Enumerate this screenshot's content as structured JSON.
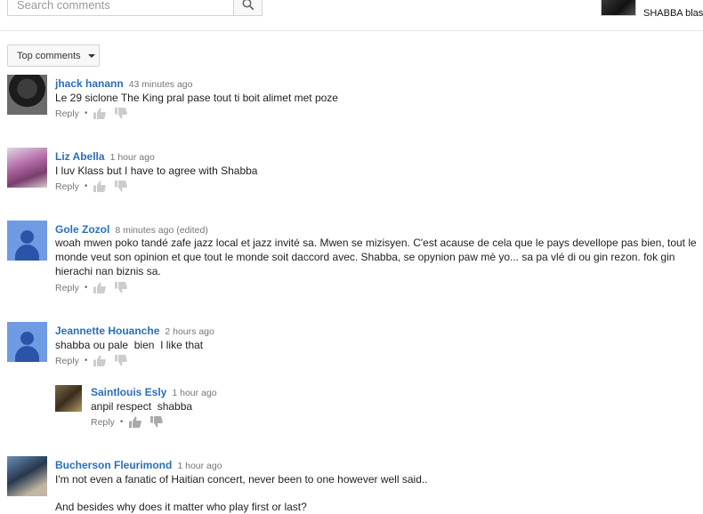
{
  "search": {
    "placeholder": "Search comments"
  },
  "channel": {
    "name": "SHABBA blast"
  },
  "sort": {
    "label": "Top comments"
  },
  "actions": {
    "reply": "Reply",
    "separator": "•"
  },
  "comments": [
    {
      "author": "jhack hanann",
      "time": "43 minutes ago",
      "text": "Le 29 siclone The King pral pase tout ti boit alimet met poze"
    },
    {
      "author": "Liz Abella",
      "time": "1 hour ago",
      "text": "I luv Klass but I have to agree with Shabba"
    },
    {
      "author": "Gole Zozol",
      "time": "8 minutes ago (edited)",
      "text": "woah mwen poko tandé zafe jazz local et jazz invité sa. Mwen se mizisyen. C'est acause de cela que le pays devellope pas bien, tout le monde veut son opinion et que tout le monde soit daccord avec. Shabba, se opynion paw mè yo... sa pa vlé di ou gin rezon. fok gin hierachi nan biznis sa."
    },
    {
      "author": "Jeannette Houanche",
      "time": "2 hours ago",
      "text": "shabba ou pale  bien  I like that"
    },
    {
      "author": "Saintlouis Esly",
      "time": "1 hour ago",
      "text": "anpil respect  shabba"
    },
    {
      "author": "Bucherson Fleurimond",
      "time": "1 hour ago",
      "text": "I'm not even a fanatic of Haitian concert, never been to one however well said..",
      "text2": "And besides why does it matter who play first or last?"
    }
  ],
  "icons": {
    "search": "search-icon",
    "like": "thumbs-up-icon",
    "dislike": "thumbs-down-icon",
    "sort": "chevron-down-icon"
  }
}
